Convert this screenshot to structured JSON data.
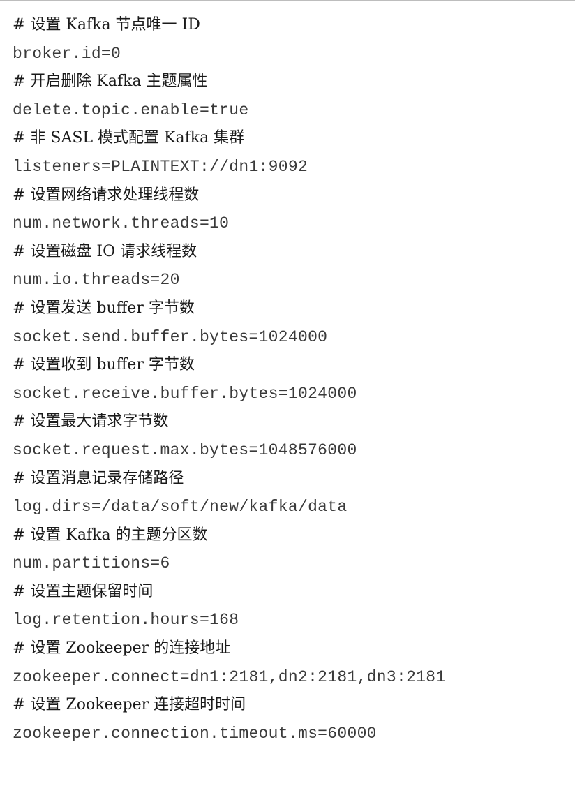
{
  "config_lines": [
    {
      "type": "comment",
      "text": "# 设置 Kafka 节点唯一 ID"
    },
    {
      "type": "code",
      "text": "broker.id=0"
    },
    {
      "type": "comment",
      "text": "# 开启删除 Kafka 主题属性"
    },
    {
      "type": "code",
      "text": "delete.topic.enable=true"
    },
    {
      "type": "comment",
      "text": "# 非 SASL 模式配置 Kafka 集群"
    },
    {
      "type": "code",
      "text": "listeners=PLAINTEXT://dn1:9092"
    },
    {
      "type": "comment",
      "text": "# 设置网络请求处理线程数"
    },
    {
      "type": "code",
      "text": "num.network.threads=10"
    },
    {
      "type": "comment",
      "text": "# 设置磁盘 IO 请求线程数"
    },
    {
      "type": "code",
      "text": "num.io.threads=20"
    },
    {
      "type": "comment",
      "text": "# 设置发送 buffer 字节数"
    },
    {
      "type": "code",
      "text": "socket.send.buffer.bytes=1024000"
    },
    {
      "type": "comment",
      "text": "# 设置收到 buffer 字节数"
    },
    {
      "type": "code",
      "text": "socket.receive.buffer.bytes=1024000"
    },
    {
      "type": "comment",
      "text": "# 设置最大请求字节数"
    },
    {
      "type": "code",
      "text": "socket.request.max.bytes=1048576000"
    },
    {
      "type": "comment",
      "text": "# 设置消息记录存储路径"
    },
    {
      "type": "code",
      "text": "log.dirs=/data/soft/new/kafka/data"
    },
    {
      "type": "comment",
      "text": "# 设置 Kafka 的主题分区数"
    },
    {
      "type": "code",
      "text": "num.partitions=6"
    },
    {
      "type": "comment",
      "text": "# 设置主题保留时间"
    },
    {
      "type": "code",
      "text": "log.retention.hours=168"
    },
    {
      "type": "comment",
      "text": "# 设置 Zookeeper 的连接地址"
    },
    {
      "type": "code",
      "text": "zookeeper.connect=dn1:2181,dn2:2181,dn3:2181"
    },
    {
      "type": "comment",
      "text": "# 设置 Zookeeper 连接超时时间"
    },
    {
      "type": "code",
      "text": "zookeeper.connection.timeout.ms=60000"
    }
  ]
}
